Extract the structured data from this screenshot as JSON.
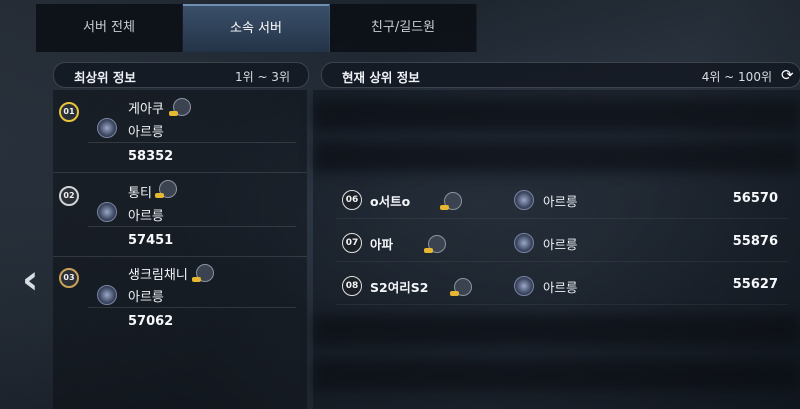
{
  "tabs": [
    {
      "label": "서버 전체"
    },
    {
      "label": "소속 서버"
    },
    {
      "label": "친구/길드원"
    }
  ],
  "left_header": {
    "title": "최상위 정보",
    "range": "1위 ~ 3위"
  },
  "right_header": {
    "title": "현재 상위 정보",
    "range": "4위 ~ 100위"
  },
  "top_players": [
    {
      "rank": "01",
      "name": "게아쿠",
      "server": "아르릉",
      "score": "58352"
    },
    {
      "rank": "02",
      "name": "통티",
      "server": "아르릉",
      "score": "57451"
    },
    {
      "rank": "03",
      "name": "생크림채니",
      "server": "아르릉",
      "score": "57062"
    }
  ],
  "ranking_rows": [
    {
      "rank": "06",
      "name": "o서트o",
      "server": "아르릉",
      "score": "56570"
    },
    {
      "rank": "07",
      "name": "아파",
      "server": "아르릉",
      "score": "55876"
    },
    {
      "rank": "08",
      "name": "S2여리S2",
      "server": "아르릉",
      "score": "55627"
    }
  ],
  "icons": {
    "back": "chevron-left-icon",
    "refresh": "refresh-icon",
    "emblem": "guild-emblem-icon",
    "class": "class-icon"
  }
}
